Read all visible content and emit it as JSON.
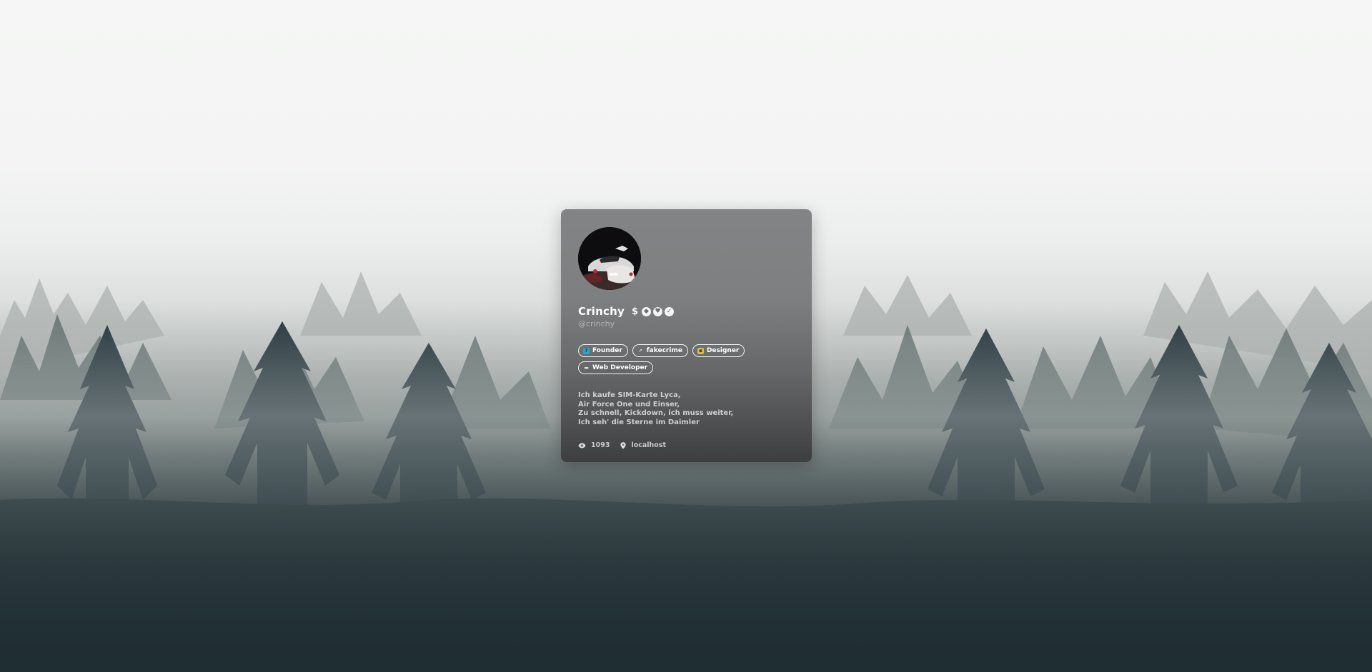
{
  "profile": {
    "display_name": "Crinchy",
    "username": "@crinchy",
    "avatar_icon": "avatar-car-night-photo",
    "badges": [
      {
        "icon": "dollar-icon",
        "glyph": "$"
      },
      {
        "icon": "diamond-icon",
        "glyph": "◆"
      },
      {
        "icon": "heart-icon",
        "glyph": "♥"
      },
      {
        "icon": "verified-icon",
        "glyph": "✓"
      }
    ],
    "tags": [
      {
        "label": "Founder",
        "icon": "founder-emoji-icon",
        "color": "#2aa7c9"
      },
      {
        "label": "fakecrime",
        "icon": "rocket-emoji-icon",
        "color": "#c9c9d0"
      },
      {
        "label": "Designer",
        "icon": "palette-emoji-icon",
        "color": "#d9b84a"
      },
      {
        "label": "Web Developer",
        "icon": "laptop-emoji-icon",
        "color": "#8a8f96"
      }
    ],
    "bio_lines": [
      "Ich kaufe SIM-Karte Lyca,",
      "Air Force One und Einser,",
      "Zu schnell, Kickdown, ich muss weiter,",
      "Ich seh' die Sterne im Daimler"
    ],
    "stats": {
      "views": "1093",
      "views_icon": "eye-icon",
      "location": "localhost",
      "location_icon": "map-pin-icon"
    }
  },
  "colors": {
    "card_bg": "#7d7f80",
    "fog": "#f3f4f3",
    "forest_dark": "#1d2b30"
  }
}
